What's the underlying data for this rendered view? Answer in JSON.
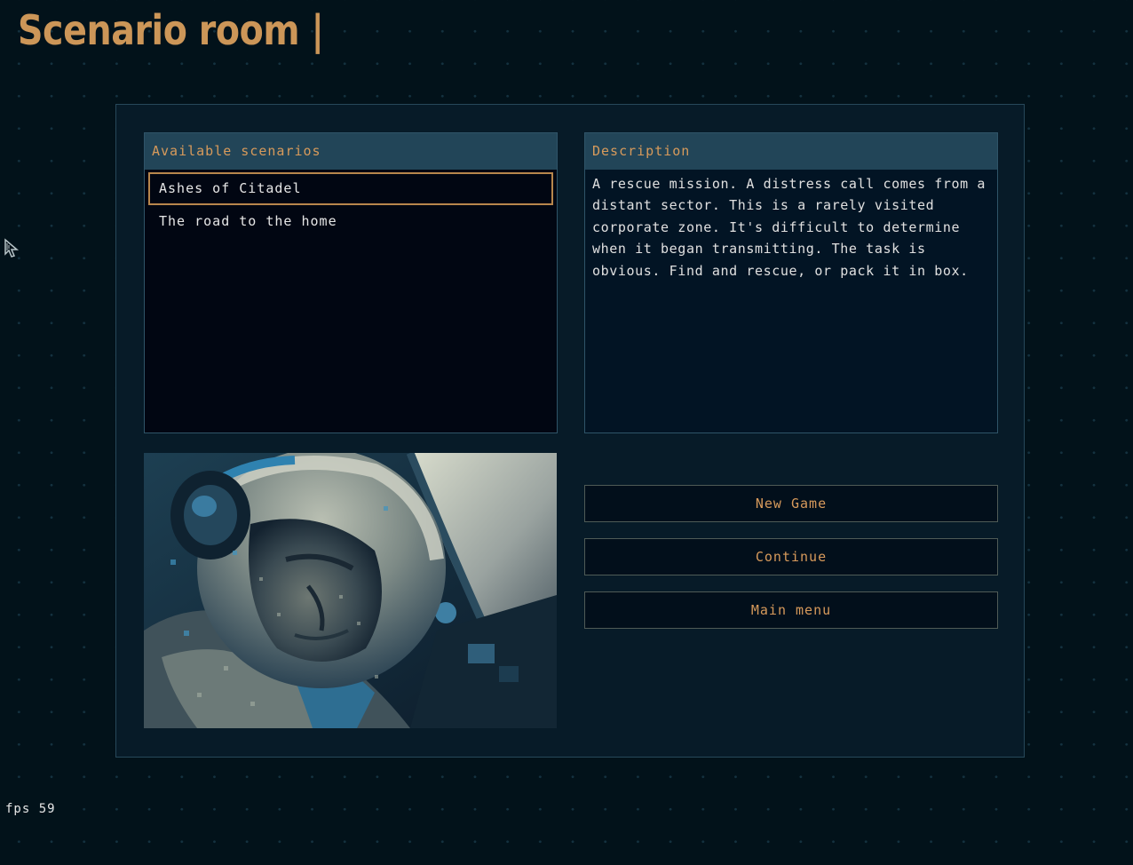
{
  "title": "Scenario room |",
  "scenarios": {
    "header": "Available scenarios",
    "items": [
      {
        "label": "Ashes of Citadel",
        "selected": true
      },
      {
        "label": "The road to the home",
        "selected": false
      }
    ]
  },
  "description": {
    "header": "Description",
    "text": "A rescue mission. A distress call comes from a distant sector. This is a rarely visited corporate zone. It's difficult to determine when it began transmitting. The task is obvious. Find and rescue, or pack it in box."
  },
  "buttons": {
    "new_game": "New Game",
    "continue": "Continue",
    "main_menu": "Main menu"
  },
  "status": {
    "fps": "fps 59"
  },
  "colors": {
    "accent": "#d79a5b",
    "background": "#02121a",
    "panel": "#071b28",
    "header": "#224558"
  },
  "icons": {
    "cursor": "pointer-cursor-icon"
  }
}
